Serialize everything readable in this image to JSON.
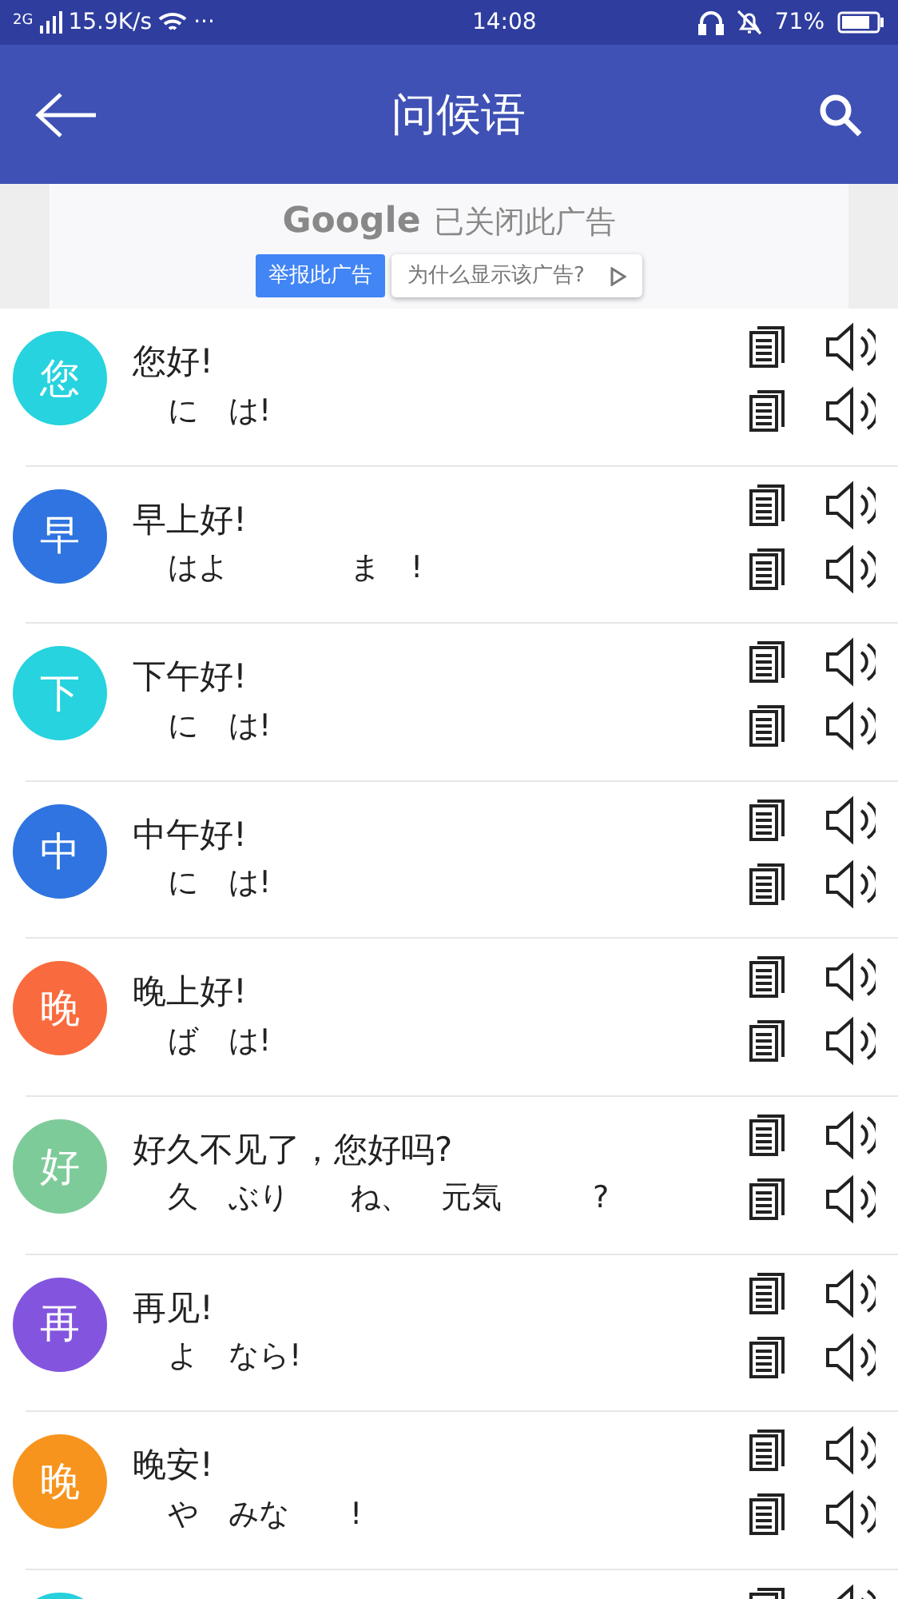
{
  "status_bar": {
    "network": "2G",
    "speed": "15.9K/s",
    "more": "···",
    "time": "14:08",
    "battery": "71%"
  },
  "header": {
    "title": "问候语"
  },
  "ad": {
    "logo": "Google",
    "message": "已关闭此广告",
    "report_button": "举报此广告",
    "why_button": "为什么显示该广告?"
  },
  "phrases": [
    {
      "avatar": "您",
      "color": "#26d3de",
      "chinese": "您好!",
      "japanese": "に　は!"
    },
    {
      "avatar": "早",
      "color": "#2f74e0",
      "chinese": "早上好!",
      "japanese": "はよ　　　　ま　!"
    },
    {
      "avatar": "下",
      "color": "#26d3de",
      "chinese": "下午好!",
      "japanese": "に　は!"
    },
    {
      "avatar": "中",
      "color": "#2f74e0",
      "chinese": "中午好!",
      "japanese": "に　は!"
    },
    {
      "avatar": "晚",
      "color": "#f96b3e",
      "chinese": "晚上好!",
      "japanese": "ば　は!"
    },
    {
      "avatar": "好",
      "color": "#7ecb9a",
      "chinese": "好久不见了，您好吗?",
      "japanese": "久　ぶり　　ね、　元気　　　?"
    },
    {
      "avatar": "再",
      "color": "#8355de",
      "chinese": "再见!",
      "japanese": "よ　なら!"
    },
    {
      "avatar": "晚",
      "color": "#f7941d",
      "chinese": "晚安!",
      "japanese": "や　みな　　!"
    },
    {
      "color": "#26d0dc"
    }
  ]
}
